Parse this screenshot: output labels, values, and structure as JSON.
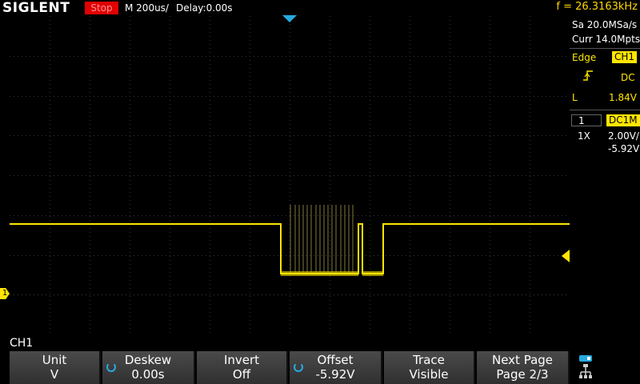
{
  "topbar": {
    "brand": "SIGLENT",
    "run_state": "Stop",
    "timebase": "M 200us/",
    "delay": "Delay:0.00s",
    "frequency": "f = 26.3163kHz"
  },
  "acquisition": {
    "sample_rate": "Sa 20.0MSa/s",
    "memory_depth": "Curr 14.0Mpts"
  },
  "trigger": {
    "type": "Edge",
    "source": "CH1",
    "slope_icon": "rising-edge-icon",
    "coupling": "DC",
    "level_prefix": "L",
    "level": "1.84V"
  },
  "channel": {
    "number": "1",
    "coupling": "DC1M",
    "probe": "1X",
    "scale": "2.00V/",
    "offset": "-5.92V",
    "label": "CH1",
    "marker": "1"
  },
  "softkeys": [
    {
      "title": "Unit",
      "value": "V",
      "knob": false
    },
    {
      "title": "Deskew",
      "value": "0.00s",
      "knob": true
    },
    {
      "title": "Invert",
      "value": "Off",
      "knob": false
    },
    {
      "title": "Offset",
      "value": "-5.92V",
      "knob": true
    },
    {
      "title": "Trace",
      "value": "Visible",
      "knob": false
    },
    {
      "title": "Next Page",
      "value": "Page 2/3",
      "knob": false
    }
  ],
  "colors": {
    "channel1": "#ffe600",
    "trigger_marker": "#27a9e1",
    "stop": "#e00000",
    "frequency": "#ffd700"
  }
}
